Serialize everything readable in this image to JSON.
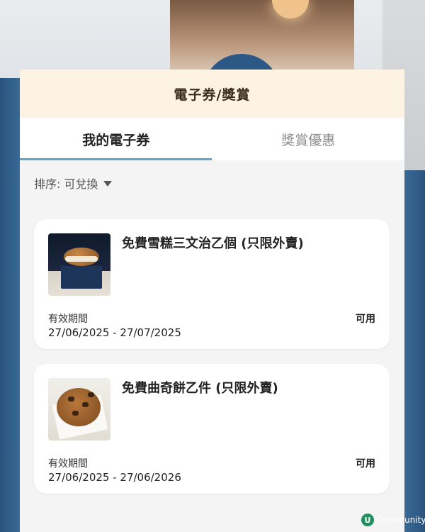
{
  "header": {
    "title": "電子券/獎賞"
  },
  "tabs": [
    {
      "label": "我的電子券",
      "active": true
    },
    {
      "label": "獎賞優惠",
      "active": false
    }
  ],
  "sort": {
    "label": "排序: 可兌換"
  },
  "vouchers": [
    {
      "title": "免費雪糕三文治乙個 (只限外賣)",
      "validity_label": "有效期間",
      "validity": "27/06/2025 - 27/07/2025",
      "status": "可用"
    },
    {
      "title": "免費曲奇餅乙件 (只限外賣)",
      "validity_label": "有效期間",
      "validity": "27/06/2025 - 27/06/2026",
      "status": "可用"
    }
  ],
  "watermark": {
    "logo_letter": "U",
    "text": "Community"
  },
  "colors": {
    "header_bg": "#fcf3e2",
    "tab_underline": "#5aa9c9",
    "screen_bg": "#f4f4f5"
  }
}
